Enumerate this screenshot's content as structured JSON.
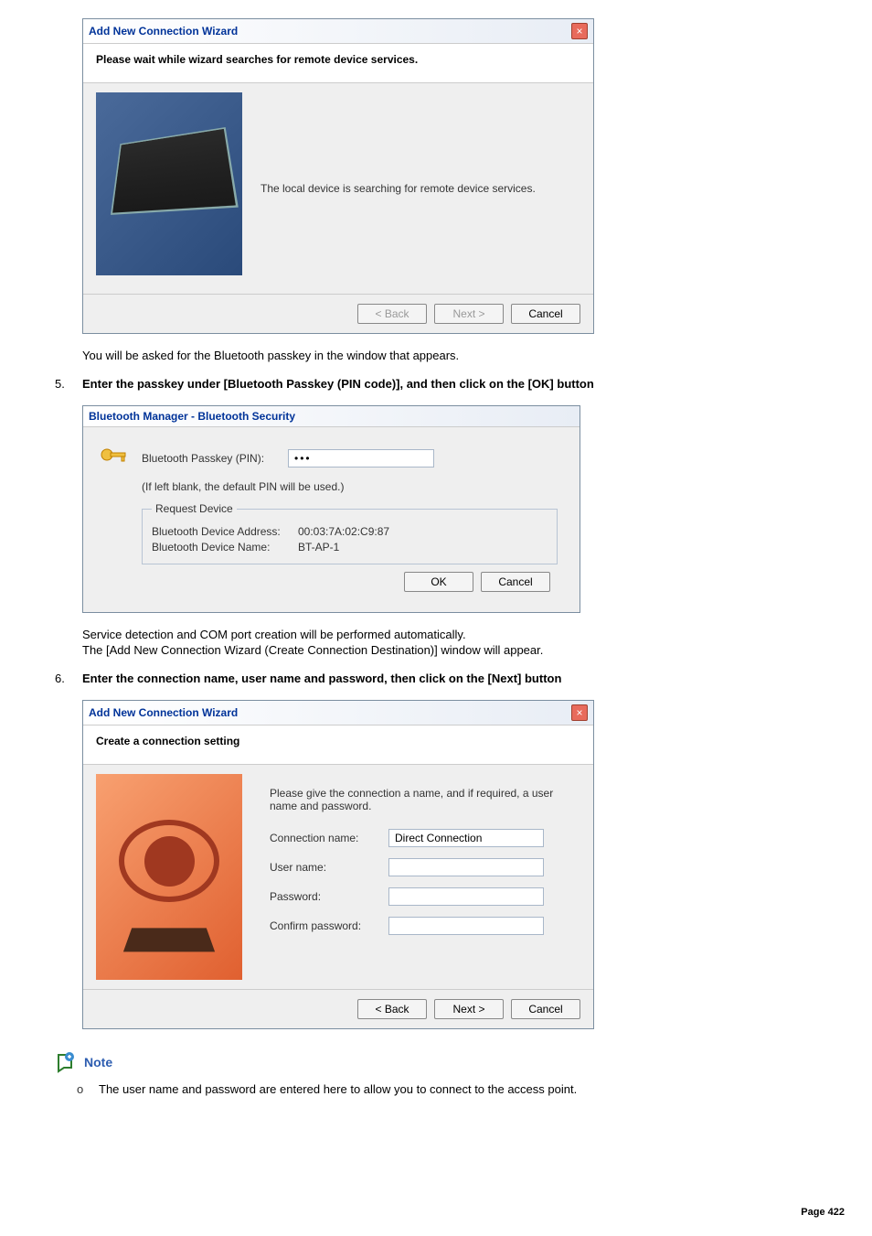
{
  "dialog1": {
    "title": "Add New Connection Wizard",
    "header": "Please wait while wizard searches for remote device services.",
    "body": "The local device is searching for remote device services.",
    "back": "< Back",
    "next": "Next >",
    "cancel": "Cancel"
  },
  "text_after_d1": "You will be asked for the Bluetooth passkey in the window that appears.",
  "step5": {
    "num": "5.",
    "text": "Enter the passkey under [Bluetooth Passkey (PIN code)], and then click on the [OK] button"
  },
  "dialog2": {
    "title": "Bluetooth Manager - Bluetooth Security",
    "pin_label": "Bluetooth Passkey (PIN):",
    "pin_value": "•••",
    "pin_hint": "(If left blank, the default PIN will be used.)",
    "fieldset_legend": "Request Device",
    "addr_label": "Bluetooth Device Address:",
    "addr_value": "00:03:7A:02:C9:87",
    "name_label": "Bluetooth Device Name:",
    "name_value": "BT-AP-1",
    "ok": "OK",
    "cancel": "Cancel"
  },
  "text_after_d2_l1": "Service detection and COM port creation will be performed automatically.",
  "text_after_d2_l2": "The [Add New Connection Wizard (Create Connection Destination)] window will appear.",
  "step6": {
    "num": "6.",
    "text": "Enter the connection name, user name and password, then click on the [Next] button"
  },
  "dialog3": {
    "title": "Add New Connection Wizard",
    "header": "Create a connection setting",
    "instr": "Please give the connection a name, and if required, a user name and password.",
    "conn_label": "Connection name:",
    "conn_value": "Direct Connection",
    "user_label": "User name:",
    "pass_label": "Password:",
    "confirm_label": "Confirm password:",
    "back": "< Back",
    "next": "Next >",
    "cancel": "Cancel"
  },
  "note": {
    "label": "Note",
    "bullet": "o",
    "item": "The user name and password are entered here to allow you to connect to the access point."
  },
  "page": "Page 422"
}
